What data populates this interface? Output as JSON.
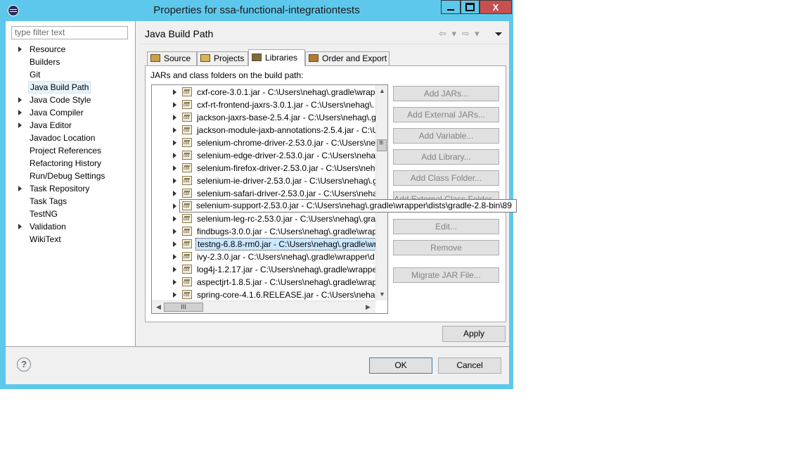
{
  "window": {
    "title": "Properties for ssa-functional-integrationtests",
    "close_label": "X"
  },
  "filter": {
    "placeholder": "type filter text"
  },
  "nav": {
    "items": [
      {
        "label": "Resource",
        "expandable": true
      },
      {
        "label": "Builders",
        "expandable": false
      },
      {
        "label": "Git",
        "expandable": false
      },
      {
        "label": "Java Build Path",
        "expandable": false,
        "selected": true
      },
      {
        "label": "Java Code Style",
        "expandable": true
      },
      {
        "label": "Java Compiler",
        "expandable": true
      },
      {
        "label": "Java Editor",
        "expandable": true
      },
      {
        "label": "Javadoc Location",
        "expandable": false
      },
      {
        "label": "Project References",
        "expandable": false
      },
      {
        "label": "Refactoring History",
        "expandable": false
      },
      {
        "label": "Run/Debug Settings",
        "expandable": false
      },
      {
        "label": "Task Repository",
        "expandable": true
      },
      {
        "label": "Task Tags",
        "expandable": false
      },
      {
        "label": "TestNG",
        "expandable": false
      },
      {
        "label": "Validation",
        "expandable": true
      },
      {
        "label": "WikiText",
        "expandable": false
      }
    ]
  },
  "main": {
    "title": "Java Build Path",
    "nav_arrows": "⇦ ▾ ⇨ ▾",
    "tabs": [
      {
        "label": "Source",
        "icon": "source-folder-icon"
      },
      {
        "label": "Projects",
        "icon": "projects-folder-icon"
      },
      {
        "label": "Libraries",
        "icon": "libraries-icon",
        "active": true
      },
      {
        "label": "Order and Export",
        "icon": "order-export-icon"
      }
    ],
    "panel_label": "JARs and class folders on the build path:",
    "jars": [
      "cxf-core-3.0.1.jar - C:\\Users\\nehag\\.gradle\\wrapp",
      "cxf-rt-frontend-jaxrs-3.0.1.jar - C:\\Users\\nehag\\.",
      "jackson-jaxrs-base-2.5.4.jar - C:\\Users\\nehag\\.gr",
      "jackson-module-jaxb-annotations-2.5.4.jar - C:\\U",
      "selenium-chrome-driver-2.53.0.jar - C:\\Users\\neh",
      "selenium-edge-driver-2.53.0.jar - C:\\Users\\nehag",
      "selenium-firefox-driver-2.53.0.jar - C:\\Users\\neha",
      "selenium-ie-driver-2.53.0.jar - C:\\Users\\nehag\\.g",
      "selenium-safari-driver-2.53.0.jar - C:\\Users\\neha",
      "selenium-support-2.53.0.jar - C:\\Users\\nehag\\.gradle",
      "selenium-leg-rc-2.53.0.jar - C:\\Users\\nehag\\.grad",
      "findbugs-3.0.0.jar - C:\\Users\\nehag\\.gradle\\wrap",
      "testng-6.8.8-rm0.jar - C:\\Users\\nehag\\.gradle\\wr",
      "ivy-2.3.0.jar - C:\\Users\\nehag\\.gradle\\wrapper\\d",
      "log4j-1.2.17.jar - C:\\Users\\nehag\\.gradle\\wrappe",
      "aspectjrt-1.8.5.jar - C:\\Users\\nehag\\.gradle\\wrap",
      "spring-core-4.1.6.RELEASE.jar - C:\\Users\\nehag\\."
    ],
    "tooltip": "selenium-support-2.53.0.jar - C:\\Users\\nehag\\.gradle\\wrapper\\dists\\gradle-2.8-bin\\89",
    "buttons": [
      {
        "label": "Add JARs...",
        "name": "add-jars-button"
      },
      {
        "label": "Add External JARs...",
        "name": "add-external-jars-button"
      },
      {
        "label": "Add Variable...",
        "name": "add-variable-button"
      },
      {
        "label": "Add Library...",
        "name": "add-library-button"
      },
      {
        "label": "Add Class Folder...",
        "name": "add-class-folder-button"
      },
      {
        "label": "Add External Class Folder...",
        "name": "add-external-class-folder-button"
      },
      {
        "label": "Edit...",
        "name": "edit-button"
      },
      {
        "label": "Remove",
        "name": "remove-button"
      },
      {
        "label": "Migrate JAR File...",
        "name": "migrate-jar-button"
      }
    ],
    "apply_label": "Apply"
  },
  "footer": {
    "help": "?",
    "ok_label": "OK",
    "cancel_label": "Cancel"
  }
}
